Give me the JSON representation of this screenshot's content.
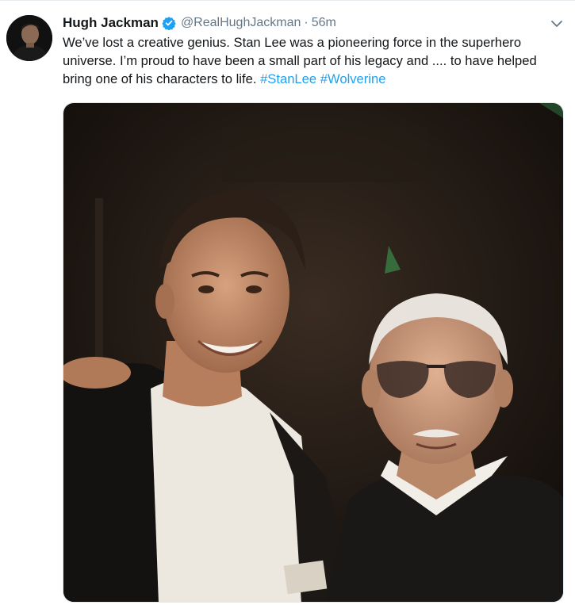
{
  "tweet": {
    "author_name": "Hugh Jackman",
    "handle": "@RealHughJackman",
    "separator": "·",
    "time": "56m",
    "text_main": "We’ve lost a creative genius. Stan Lee was a pioneering force in the superhero universe. I’m proud to have been a small part of his legacy and .... to have helped bring one of his characters to life.",
    "hashtags": [
      "#StanLee",
      "#Wolverine"
    ]
  },
  "icons": {
    "verified": "verified-badge-icon",
    "menu": "chevron-down-icon"
  },
  "colors": {
    "accent": "#1da1f2",
    "text": "#14171a",
    "muted": "#657786"
  }
}
